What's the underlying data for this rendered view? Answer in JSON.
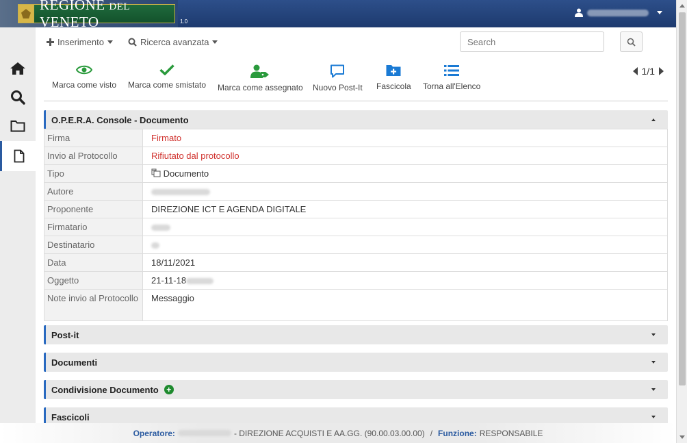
{
  "header": {
    "logo_main": "REGIONE",
    "logo_small": "DEL",
    "logo_end": "VENETO",
    "version": "1.0"
  },
  "menu": {
    "insert_label": "Inserimento",
    "advanced_search_label": "Ricerca avanzata",
    "search_placeholder": "Search"
  },
  "toolbar": {
    "mark_seen": "Marca come visto",
    "mark_dispatched": "Marca come smistato",
    "mark_assigned": "Marca come assegnato",
    "new_postit": "Nuovo Post-It",
    "file": "Fascicola",
    "back_to_list": "Torna all'Elenco",
    "pager": "1/1"
  },
  "document": {
    "panel_title": "O.P.E.R.A. Console - Documento",
    "rows": [
      {
        "label": "Firma",
        "value": "Firmato"
      },
      {
        "label": "Invio al Protocollo",
        "value": "Rifiutato dal protocollo"
      },
      {
        "label": "Tipo",
        "value": "Documento"
      },
      {
        "label": "Autore",
        "value": ""
      },
      {
        "label": "Proponente",
        "value": "DIREZIONE ICT E AGENDA DIGITALE"
      },
      {
        "label": "Firmatario",
        "value": ""
      },
      {
        "label": "Destinatario",
        "value": ""
      },
      {
        "label": "Data",
        "value": "18/11/2021"
      },
      {
        "label": "Oggetto",
        "value": "21-11-18"
      },
      {
        "label": "Note invio al Protocollo",
        "value": "Messaggio"
      }
    ]
  },
  "panels": {
    "postit": "Post-it",
    "documents": "Documenti",
    "sharing": "Condivisione Documento",
    "folders": "Fascicoli"
  },
  "footer": {
    "operator_label": "Operatore:",
    "department": "- DIREZIONE ACQUISTI E AA.GG. (90.00.03.00.00)",
    "separator": "/",
    "function_label": "Funzione:",
    "function_value": "RESPONSABILE"
  },
  "colors": {
    "accent": "#2a6ac0",
    "brand_green": "#1f6a3c",
    "status_red": "#d0312d"
  }
}
